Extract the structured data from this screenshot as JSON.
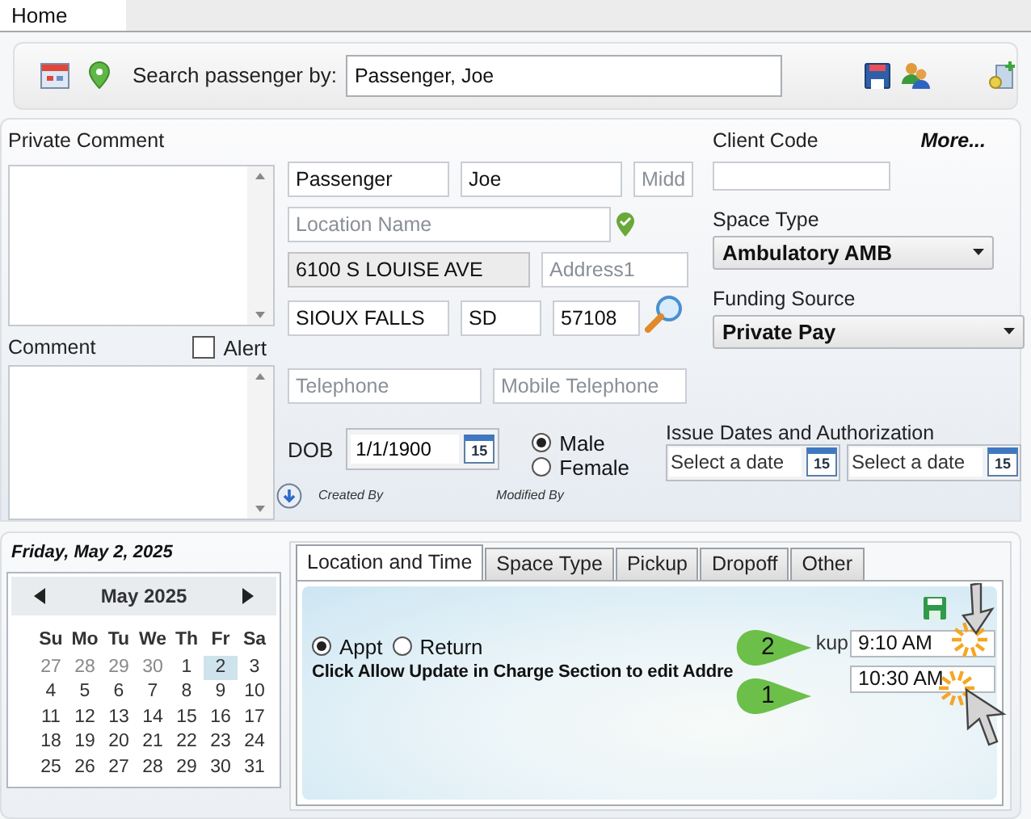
{
  "home_tab": {
    "label": "Home",
    "selected": true
  },
  "toolbar": {
    "search_label": "Search passenger by:",
    "search_value": "Passenger, Joe"
  },
  "private_comment": {
    "label": "Private Comment"
  },
  "comment": {
    "label": "Comment",
    "alert": {
      "label": "Alert",
      "checked": false
    }
  },
  "name_fields": [
    {
      "value": "Passenger"
    },
    {
      "value": "Joe"
    },
    {
      "placeholder": "Midd"
    }
  ],
  "location": {
    "placeholder": "Location Name"
  },
  "address_fields": [
    {
      "value": "6100 S LOUISE AVE",
      "disabled": true
    },
    {
      "placeholder": "Address1",
      "disabled": false
    }
  ],
  "city_fields": [
    {
      "value": "SIOUX FALLS"
    },
    {
      "value": "SD"
    },
    {
      "value": "57108"
    }
  ],
  "phone_fields": [
    {
      "placeholder": "Telephone"
    },
    {
      "placeholder": "Mobile Telephone"
    }
  ],
  "dob": {
    "label": "DOB",
    "value": "1/1/1900",
    "calendar_day": "15"
  },
  "gender": [
    {
      "label": "Male",
      "selected": true
    },
    {
      "label": "Female",
      "selected": false
    }
  ],
  "audit": [
    "Created By",
    "Modified By"
  ],
  "client_code": {
    "label": "Client Code"
  },
  "more_link": "More...",
  "space_type": {
    "label": "Space Type",
    "value": "Ambulatory AMB"
  },
  "funding_source": {
    "label": "Funding Source",
    "value": "Private Pay"
  },
  "issue_dates": {
    "label": "Issue Dates and Authorization",
    "fields": [
      {
        "placeholder": "Select a date",
        "calendar_day": "15"
      },
      {
        "placeholder": "Select a date",
        "calendar_day": "15"
      }
    ]
  },
  "selected_date": "Friday, May 2, 2025",
  "calendar": {
    "month": "May 2025",
    "weekdays": [
      "Su",
      "Mo",
      "Tu",
      "We",
      "Th",
      "Fr",
      "Sa"
    ],
    "weeks": [
      [
        {
          "day": "27",
          "other_month": true,
          "selected": false
        },
        {
          "day": "28",
          "other_month": true,
          "selected": false
        },
        {
          "day": "29",
          "other_month": true,
          "selected": false
        },
        {
          "day": "30",
          "other_month": true,
          "selected": false
        },
        {
          "day": "1",
          "other_month": false,
          "selected": false
        },
        {
          "day": "2",
          "other_month": false,
          "selected": true
        },
        {
          "day": "3",
          "other_month": false,
          "selected": false
        }
      ],
      [
        {
          "day": "4",
          "other_month": false,
          "selected": false
        },
        {
          "day": "5",
          "other_month": false,
          "selected": false
        },
        {
          "day": "6",
          "other_month": false,
          "selected": false
        },
        {
          "day": "7",
          "other_month": false,
          "selected": false
        },
        {
          "day": "8",
          "other_month": false,
          "selected": false
        },
        {
          "day": "9",
          "other_month": false,
          "selected": false
        },
        {
          "day": "10",
          "other_month": false,
          "selected": false
        }
      ],
      [
        {
          "day": "11",
          "other_month": false,
          "selected": false
        },
        {
          "day": "12",
          "other_month": false,
          "selected": false
        },
        {
          "day": "13",
          "other_month": false,
          "selected": false
        },
        {
          "day": "14",
          "other_month": false,
          "selected": false
        },
        {
          "day": "15",
          "other_month": false,
          "selected": false
        },
        {
          "day": "16",
          "other_month": false,
          "selected": false
        },
        {
          "day": "17",
          "other_month": false,
          "selected": false
        }
      ],
      [
        {
          "day": "18",
          "other_month": false,
          "selected": false
        },
        {
          "day": "19",
          "other_month": false,
          "selected": false
        },
        {
          "day": "20",
          "other_month": false,
          "selected": false
        },
        {
          "day": "21",
          "other_month": false,
          "selected": false
        },
        {
          "day": "22",
          "other_month": false,
          "selected": false
        },
        {
          "day": "23",
          "other_month": false,
          "selected": false
        },
        {
          "day": "24",
          "other_month": false,
          "selected": false
        }
      ],
      [
        {
          "day": "25",
          "other_month": false,
          "selected": false
        },
        {
          "day": "26",
          "other_month": false,
          "selected": false
        },
        {
          "day": "27",
          "other_month": false,
          "selected": false
        },
        {
          "day": "28",
          "other_month": false,
          "selected": false
        },
        {
          "day": "29",
          "other_month": false,
          "selected": false
        },
        {
          "day": "30",
          "other_month": false,
          "selected": false
        },
        {
          "day": "31",
          "other_month": false,
          "selected": false
        }
      ]
    ]
  },
  "trip_tabs": [
    {
      "label": "Location and Time",
      "selected": true
    },
    {
      "label": "Space Type",
      "selected": false
    },
    {
      "label": "Pickup",
      "selected": false
    },
    {
      "label": "Dropoff",
      "selected": false
    },
    {
      "label": "Other",
      "selected": false
    }
  ],
  "trip_type": [
    {
      "label": "Appt",
      "selected": true
    },
    {
      "label": "Return",
      "selected": false
    }
  ],
  "notice": "Click Allow Update in Charge Section to edit Addre",
  "pickup_label": "kup",
  "times": [
    {
      "value": "9:10 AM"
    },
    {
      "value": "10:30 AM"
    }
  ],
  "callouts": [
    {
      "number": "2"
    },
    {
      "number": "1"
    }
  ]
}
